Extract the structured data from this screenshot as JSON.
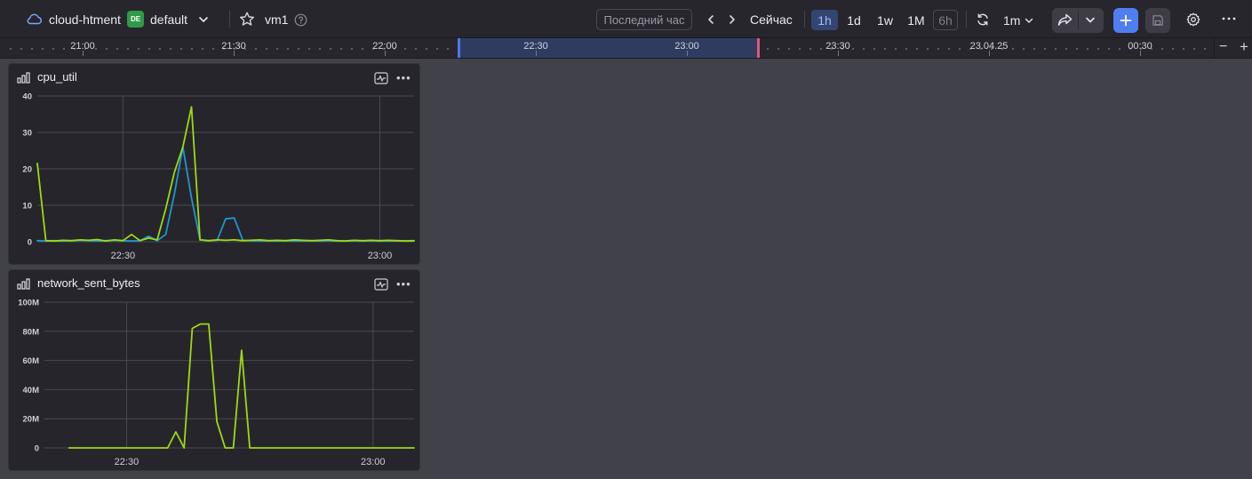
{
  "header": {
    "folder_name": "cloud-htment",
    "space_badge": "DE",
    "space_name": "default",
    "dashboard_name": "vm1",
    "range_label": "Последний час",
    "now_label": "Сейчас",
    "scales": [
      {
        "label": "1h",
        "active": true
      },
      {
        "label": "1d",
        "active": false
      },
      {
        "label": "1w",
        "active": false
      },
      {
        "label": "1M",
        "active": false
      },
      {
        "label": "6h",
        "active": false
      }
    ],
    "refresh_interval": "1m"
  },
  "timeline": {
    "labels": [
      "21:00",
      "21:30",
      "22:00",
      "22:30",
      "23:00",
      "23:30",
      "23.04.25",
      "00:30"
    ],
    "zoom_out": "−",
    "zoom_in": "+"
  },
  "panels": [
    {
      "title": "cpu_util"
    },
    {
      "title": "network_sent_bytes"
    }
  ],
  "colors": {
    "series_green": "#9ed913",
    "series_blue": "#1e96d2",
    "accent_blue": "#4f7ef0",
    "badge_green": "#2f9a48"
  },
  "chart_data": [
    {
      "type": "line",
      "title": "cpu_util",
      "ylim": [
        0,
        40
      ],
      "y_ticks": [
        "0",
        "10",
        "20",
        "30",
        "40"
      ],
      "x_tick_labels": [
        "22:30",
        "23:00"
      ],
      "xlim": [
        "22:20",
        "23:04"
      ],
      "grid": true,
      "series": [
        {
          "color": "#9ed913",
          "x": [
            "22:20",
            "22:21",
            "22:22",
            "22:23",
            "22:24",
            "22:25",
            "22:26",
            "22:27",
            "22:28",
            "22:29",
            "22:30",
            "22:31",
            "22:32",
            "22:33",
            "22:34",
            "22:35",
            "22:36",
            "22:37",
            "22:38",
            "22:39",
            "22:40",
            "22:41",
            "22:42",
            "22:43",
            "22:44",
            "22:45",
            "22:46",
            "22:47",
            "22:48",
            "22:49",
            "22:50",
            "22:51",
            "22:52",
            "22:53",
            "22:54",
            "22:55",
            "22:56",
            "22:57",
            "22:58",
            "22:59",
            "23:00",
            "23:01",
            "23:02",
            "23:03",
            "23:04"
          ],
          "values": [
            21.5,
            0.3,
            0.2,
            0.4,
            0.3,
            0.5,
            0.4,
            0.6,
            0.2,
            0.5,
            0.3,
            2,
            0.3,
            1,
            0.5,
            9,
            19,
            26,
            37,
            0.5,
            0.3,
            0.5,
            0.4,
            0.5,
            0.3,
            0.4,
            0.5,
            0.3,
            0.4,
            0.3,
            0.5,
            0.4,
            0.3,
            0.4,
            0.5,
            0.3,
            0.2,
            0.4,
            0.3,
            0.4,
            0.3,
            0.4,
            0.3,
            0.2,
            0.3
          ]
        },
        {
          "color": "#1e96d2",
          "x": [
            "22:20",
            "22:21",
            "22:22",
            "22:23",
            "22:24",
            "22:25",
            "22:26",
            "22:27",
            "22:28",
            "22:29",
            "22:30",
            "22:31",
            "22:32",
            "22:33",
            "22:34",
            "22:35",
            "22:36",
            "22:37",
            "22:38",
            "22:39",
            "22:40",
            "22:41",
            "22:42",
            "22:43",
            "22:44",
            "22:45",
            "22:46",
            "22:47",
            "22:48",
            "22:49",
            "22:50",
            "22:51",
            "22:52",
            "22:53",
            "22:54",
            "22:55",
            "22:56",
            "22:57",
            "22:58",
            "22:59",
            "23:00",
            "23:01",
            "23:02",
            "23:03",
            "23:04"
          ],
          "values": [
            0.3,
            0.2,
            0.3,
            0.2,
            0.3,
            0.4,
            0.3,
            0.2,
            0.3,
            0.4,
            0.3,
            0.2,
            0.3,
            1.5,
            0.3,
            2,
            13,
            26,
            12,
            0.5,
            0.3,
            0.4,
            6.3,
            6.5,
            0.4,
            0.3,
            0.2,
            0.3,
            0.2,
            0.3,
            0.2,
            0.2,
            0.3,
            0.2,
            0.3,
            0.2,
            0.2,
            0.3,
            0.2,
            0.3,
            0.2,
            0.2,
            0.3,
            0.2,
            0.2
          ]
        }
      ]
    },
    {
      "type": "line",
      "title": "network_sent_bytes",
      "ylim": [
        0,
        100000000
      ],
      "y_ticks": [
        "0",
        "20M",
        "40M",
        "60M",
        "80M",
        "100M"
      ],
      "x_tick_labels": [
        "22:30",
        "23:00"
      ],
      "xlim": [
        "22:20",
        "23:05"
      ],
      "grid": true,
      "series": [
        {
          "color": "#9ed913",
          "x": [
            "22:23",
            "22:34",
            "22:35",
            "22:36",
            "22:37",
            "22:38",
            "22:39",
            "22:40",
            "22:41",
            "22:42",
            "22:43",
            "22:44",
            "22:45",
            "22:46",
            "23:05"
          ],
          "values": [
            0,
            0,
            0,
            11000000,
            0,
            82000000,
            85000000,
            85000000,
            18000000,
            0,
            0,
            67000000,
            0,
            0,
            0
          ]
        }
      ]
    }
  ]
}
